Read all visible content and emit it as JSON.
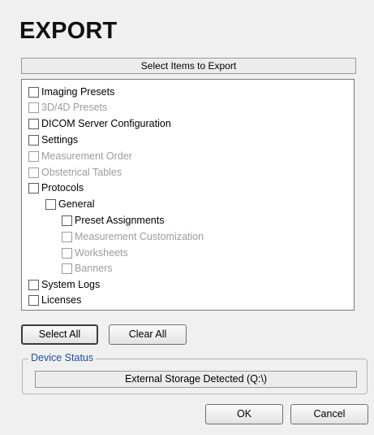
{
  "dialog": {
    "title": "EXPORT",
    "header": "Select Items to Export"
  },
  "items": [
    {
      "label": "Imaging Presets",
      "enabled": true,
      "checked": false
    },
    {
      "label": "3D/4D Presets",
      "enabled": false,
      "checked": false
    },
    {
      "label": "DICOM Server Configuration",
      "enabled": true,
      "checked": false
    },
    {
      "label": "Settings",
      "enabled": true,
      "checked": false
    },
    {
      "label": "Measurement Order",
      "enabled": false,
      "checked": false
    },
    {
      "label": "Obstetrical Tables",
      "enabled": false,
      "checked": false
    },
    {
      "label": "Protocols",
      "enabled": true,
      "checked": false
    },
    {
      "label": "General",
      "enabled": true,
      "checked": false
    },
    {
      "label": "Preset Assignments",
      "enabled": true,
      "checked": false
    },
    {
      "label": "Measurement Customization",
      "enabled": false,
      "checked": false
    },
    {
      "label": "Worksheets",
      "enabled": false,
      "checked": false
    },
    {
      "label": "Banners",
      "enabled": false,
      "checked": false
    },
    {
      "label": "System Logs",
      "enabled": true,
      "checked": false
    },
    {
      "label": "Licenses",
      "enabled": true,
      "checked": false
    }
  ],
  "buttons": {
    "select_all": "Select All",
    "clear_all": "Clear All",
    "ok": "OK",
    "cancel": "Cancel"
  },
  "device_status": {
    "label": "Device Status",
    "value": "External Storage Detected (Q:\\)"
  }
}
